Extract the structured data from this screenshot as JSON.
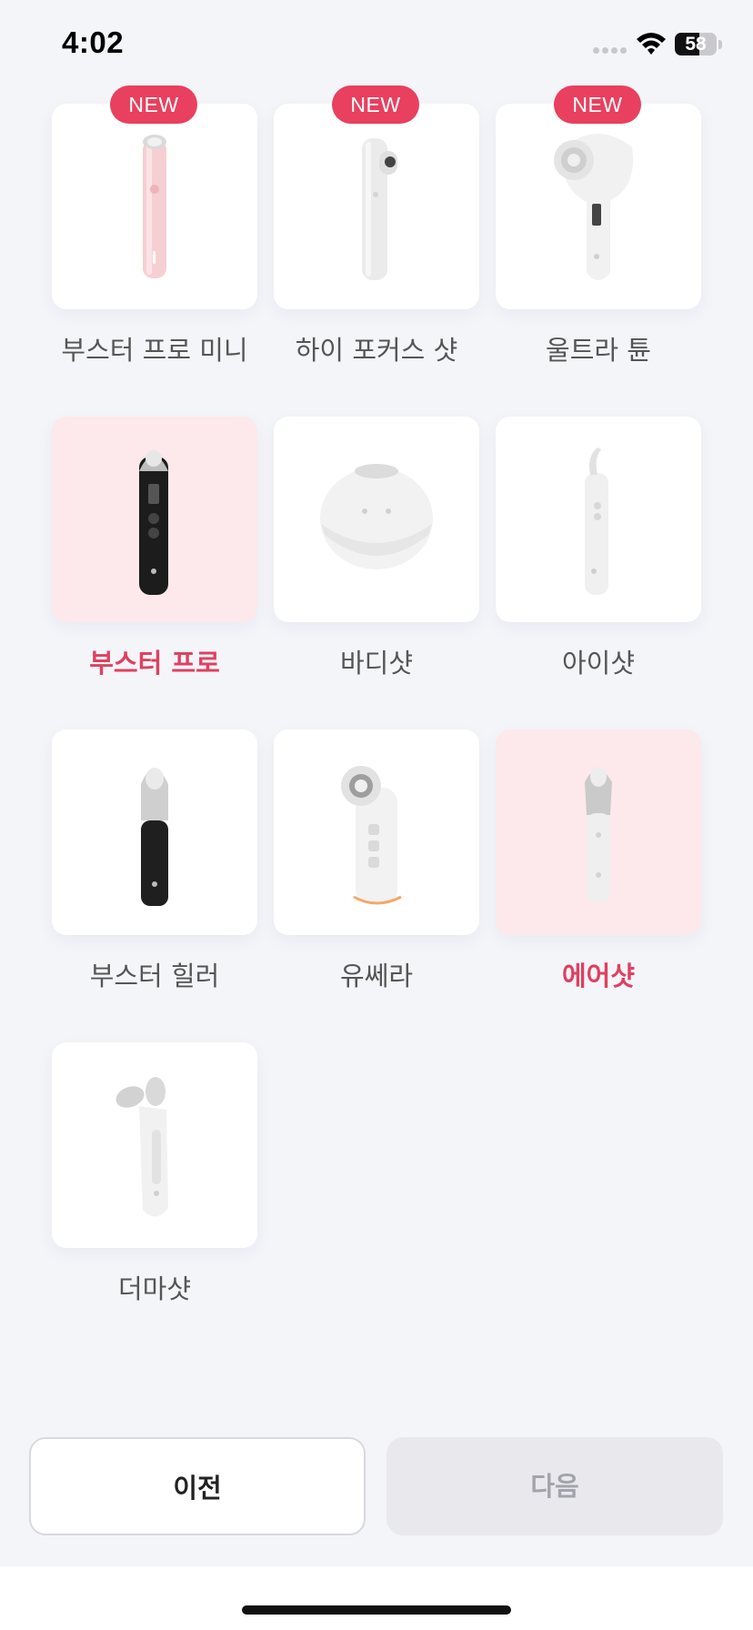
{
  "status_bar": {
    "time": "4:02",
    "battery": "58",
    "battery_level": 58
  },
  "products": [
    {
      "name": "부스터 프로 미니",
      "badge": "NEW",
      "selected": false,
      "icon": "booster-pro-mini-device-icon"
    },
    {
      "name": "하이 포커스 샷",
      "badge": "NEW",
      "selected": false,
      "icon": "high-focus-shot-device-icon"
    },
    {
      "name": "울트라 튠",
      "badge": "NEW",
      "selected": false,
      "icon": "ultra-tune-device-icon"
    },
    {
      "name": "부스터 프로",
      "badge": "",
      "selected": true,
      "icon": "booster-pro-device-icon"
    },
    {
      "name": "바디샷",
      "badge": "",
      "selected": false,
      "icon": "body-shot-device-icon"
    },
    {
      "name": "아이샷",
      "badge": "",
      "selected": false,
      "icon": "eye-shot-device-icon"
    },
    {
      "name": "부스터 힐러",
      "badge": "",
      "selected": false,
      "icon": "booster-healer-device-icon"
    },
    {
      "name": "유쎄라",
      "badge": "",
      "selected": false,
      "icon": "usera-device-icon"
    },
    {
      "name": "에어샷",
      "badge": "",
      "selected": true,
      "icon": "air-shot-device-icon"
    },
    {
      "name": "더마샷",
      "badge": "",
      "selected": false,
      "icon": "derma-shot-device-icon"
    }
  ],
  "buttons": {
    "prev": "이전",
    "next": "다음",
    "next_enabled": false
  },
  "colors": {
    "accent": "#e8405e",
    "selected_bg": "#fde8ec",
    "background": "#f4f5f9"
  }
}
